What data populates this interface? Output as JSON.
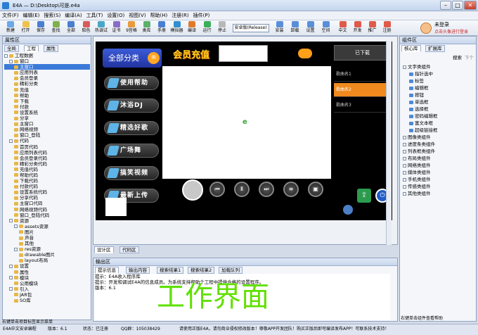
{
  "window": {
    "title": "E4A — D:\\Desktop\\可是.e4a",
    "min": "–",
    "max": "□",
    "close": "✕"
  },
  "menu": [
    "文件(F)",
    "编辑(E)",
    "搜索(S)",
    "编译(A)",
    "工具(T)",
    "设置(O)",
    "视图(V)",
    "帮助(H)",
    "注册(R)",
    "插件(P)"
  ],
  "toolbar": {
    "buttons": [
      "新建",
      "打开",
      "保存",
      "查找",
      "全部",
      "取色",
      "热调试",
      "证书",
      "9宫格",
      "类库",
      "手册",
      "模拟器",
      "编译",
      "运行",
      "停止"
    ],
    "combo": "安卓版(Release)",
    "buttons2": [
      "安装",
      "卸载",
      "设置",
      "空间"
    ],
    "buttons3": [
      "中文",
      "开发",
      "推广",
      "注册"
    ],
    "user": {
      "name": "未登录",
      "link": "点击头像进行登录"
    }
  },
  "left_panel": {
    "title": "属性区",
    "tabs": [
      "全局",
      "工程",
      "属性"
    ],
    "tree": [
      {
        "t": "工程数据",
        "d": 0,
        "box": true
      },
      {
        "t": "窗口",
        "d": 1,
        "box": true
      },
      {
        "t": "主窗口",
        "d": 2,
        "sel": true
      },
      {
        "t": "应用列表",
        "d": 2
      },
      {
        "t": "会员登录",
        "d": 2
      },
      {
        "t": "精彩分类",
        "d": 2
      },
      {
        "t": "充值",
        "d": 2
      },
      {
        "t": "帮助",
        "d": 2
      },
      {
        "t": "下载",
        "d": 2
      },
      {
        "t": "付款",
        "d": 2
      },
      {
        "t": "设置系统",
        "d": 2
      },
      {
        "t": "分享",
        "d": 2
      },
      {
        "t": "主窗口",
        "d": 2
      },
      {
        "t": "网络视频",
        "d": 2
      },
      {
        "t": "窗口_登陆",
        "d": 2
      },
      {
        "t": "代码",
        "d": 1,
        "box": true
      },
      {
        "t": "首页代码",
        "d": 2
      },
      {
        "t": "应用列表代码",
        "d": 2
      },
      {
        "t": "会员登录代码",
        "d": 2
      },
      {
        "t": "精彩分类代码",
        "d": 2
      },
      {
        "t": "充值代码",
        "d": 2
      },
      {
        "t": "帮助代码",
        "d": 2
      },
      {
        "t": "下载代码",
        "d": 2
      },
      {
        "t": "付款代码",
        "d": 2
      },
      {
        "t": "设置系统代码",
        "d": 2
      },
      {
        "t": "分享代码",
        "d": 2
      },
      {
        "t": "主窗口代码",
        "d": 2
      },
      {
        "t": "网络视频代码",
        "d": 2
      },
      {
        "t": "窗口_登陆代码",
        "d": 2
      },
      {
        "t": "资源",
        "d": 1,
        "box": true
      },
      {
        "t": "assets资源",
        "d": 2,
        "box": true
      },
      {
        "t": "图片",
        "d": 3
      },
      {
        "t": "声音",
        "d": 3
      },
      {
        "t": "其他",
        "d": 3
      },
      {
        "t": "res资源",
        "d": 2,
        "box": true
      },
      {
        "t": "drawable图片",
        "d": 3
      },
      {
        "t": "layout布局",
        "d": 3
      },
      {
        "t": "设置",
        "d": 1,
        "box": true
      },
      {
        "t": "属性",
        "d": 2
      },
      {
        "t": "模块",
        "d": 1,
        "box": true
      },
      {
        "t": "公用模块",
        "d": 2
      },
      {
        "t": "引入",
        "d": 1,
        "box": true
      },
      {
        "t": "JAR包",
        "d": 2
      },
      {
        "t": "SO库",
        "d": 2
      }
    ],
    "footer": "右键单击项目标签显示菜单"
  },
  "phone": {
    "category_title": "全部分类",
    "banner": "会员充值",
    "buttons": [
      "使用帮助",
      "沐浴DJ",
      "精选好歌",
      "广场舞",
      "搞笑视频",
      "最新上传"
    ],
    "download_tab": "已下载",
    "list": [
      "歌曲名1",
      "歌曲名2",
      "歌曲名3"
    ],
    "ctrl_buttons": [
      "⏮",
      "Ⅱ",
      "⏭",
      "≡",
      "▣"
    ],
    "share_icon": "share",
    "power_icon": "power"
  },
  "design_tabs": [
    "设计区",
    "代码区"
  ],
  "output": {
    "title": "输出区",
    "tabs": [
      "提示信息",
      "输出内容",
      "搜索结果1",
      "搜索结果2",
      "加载队列"
    ],
    "lines": [
      "提示：E4A收入程序库",
      "提示：开发和调试E4A的信息成员。为系统支持帮助个工程中提供合格的设置程序。",
      "版本：6.1"
    ],
    "watermark": "工作界面"
  },
  "right_panel": {
    "title": "组件区",
    "tabs": [
      "核心库",
      "扩展库"
    ],
    "search_label": "搜索",
    "search_value": "下个",
    "items": [
      {
        "t": "文字类组件",
        "d": 0,
        "box": true
      },
      {
        "t": "指针选中",
        "d": 1
      },
      {
        "t": "标签",
        "d": 1
      },
      {
        "t": "编辑框",
        "d": 1
      },
      {
        "t": "按钮",
        "d": 1
      },
      {
        "t": "单选框",
        "d": 1
      },
      {
        "t": "选择框",
        "d": 1
      },
      {
        "t": "密码编辑框",
        "d": 1
      },
      {
        "t": "富文本框",
        "d": 1
      },
      {
        "t": "超级链接框",
        "d": 1
      },
      {
        "t": "图像类组件",
        "d": 0,
        "box": true
      },
      {
        "t": "进度条类组件",
        "d": 0,
        "box": true
      },
      {
        "t": "列表框类组件",
        "d": 0,
        "box": true
      },
      {
        "t": "布局类组件",
        "d": 0,
        "box": true
      },
      {
        "t": "网络类组件",
        "d": 0,
        "box": true
      },
      {
        "t": "媒体类组件",
        "d": 0,
        "box": true
      },
      {
        "t": "手机类组件",
        "d": 0,
        "box": true
      },
      {
        "t": "传感类组件",
        "d": 0,
        "box": true
      },
      {
        "t": "其他类组件",
        "d": 0,
        "box": true
      }
    ],
    "footer": "右键单击组件查看帮助"
  },
  "status": {
    "left": "E4A中文安卓编程",
    "version": "版本：6.1",
    "state": "状态：已注册",
    "qq": "QQ群：105038429",
    "msg": "请使用正版E4A，请勿商业侵权修改版本！尊敬APP开发团队！购买正版后即可编译发布APP！可联系技术支持！"
  }
}
